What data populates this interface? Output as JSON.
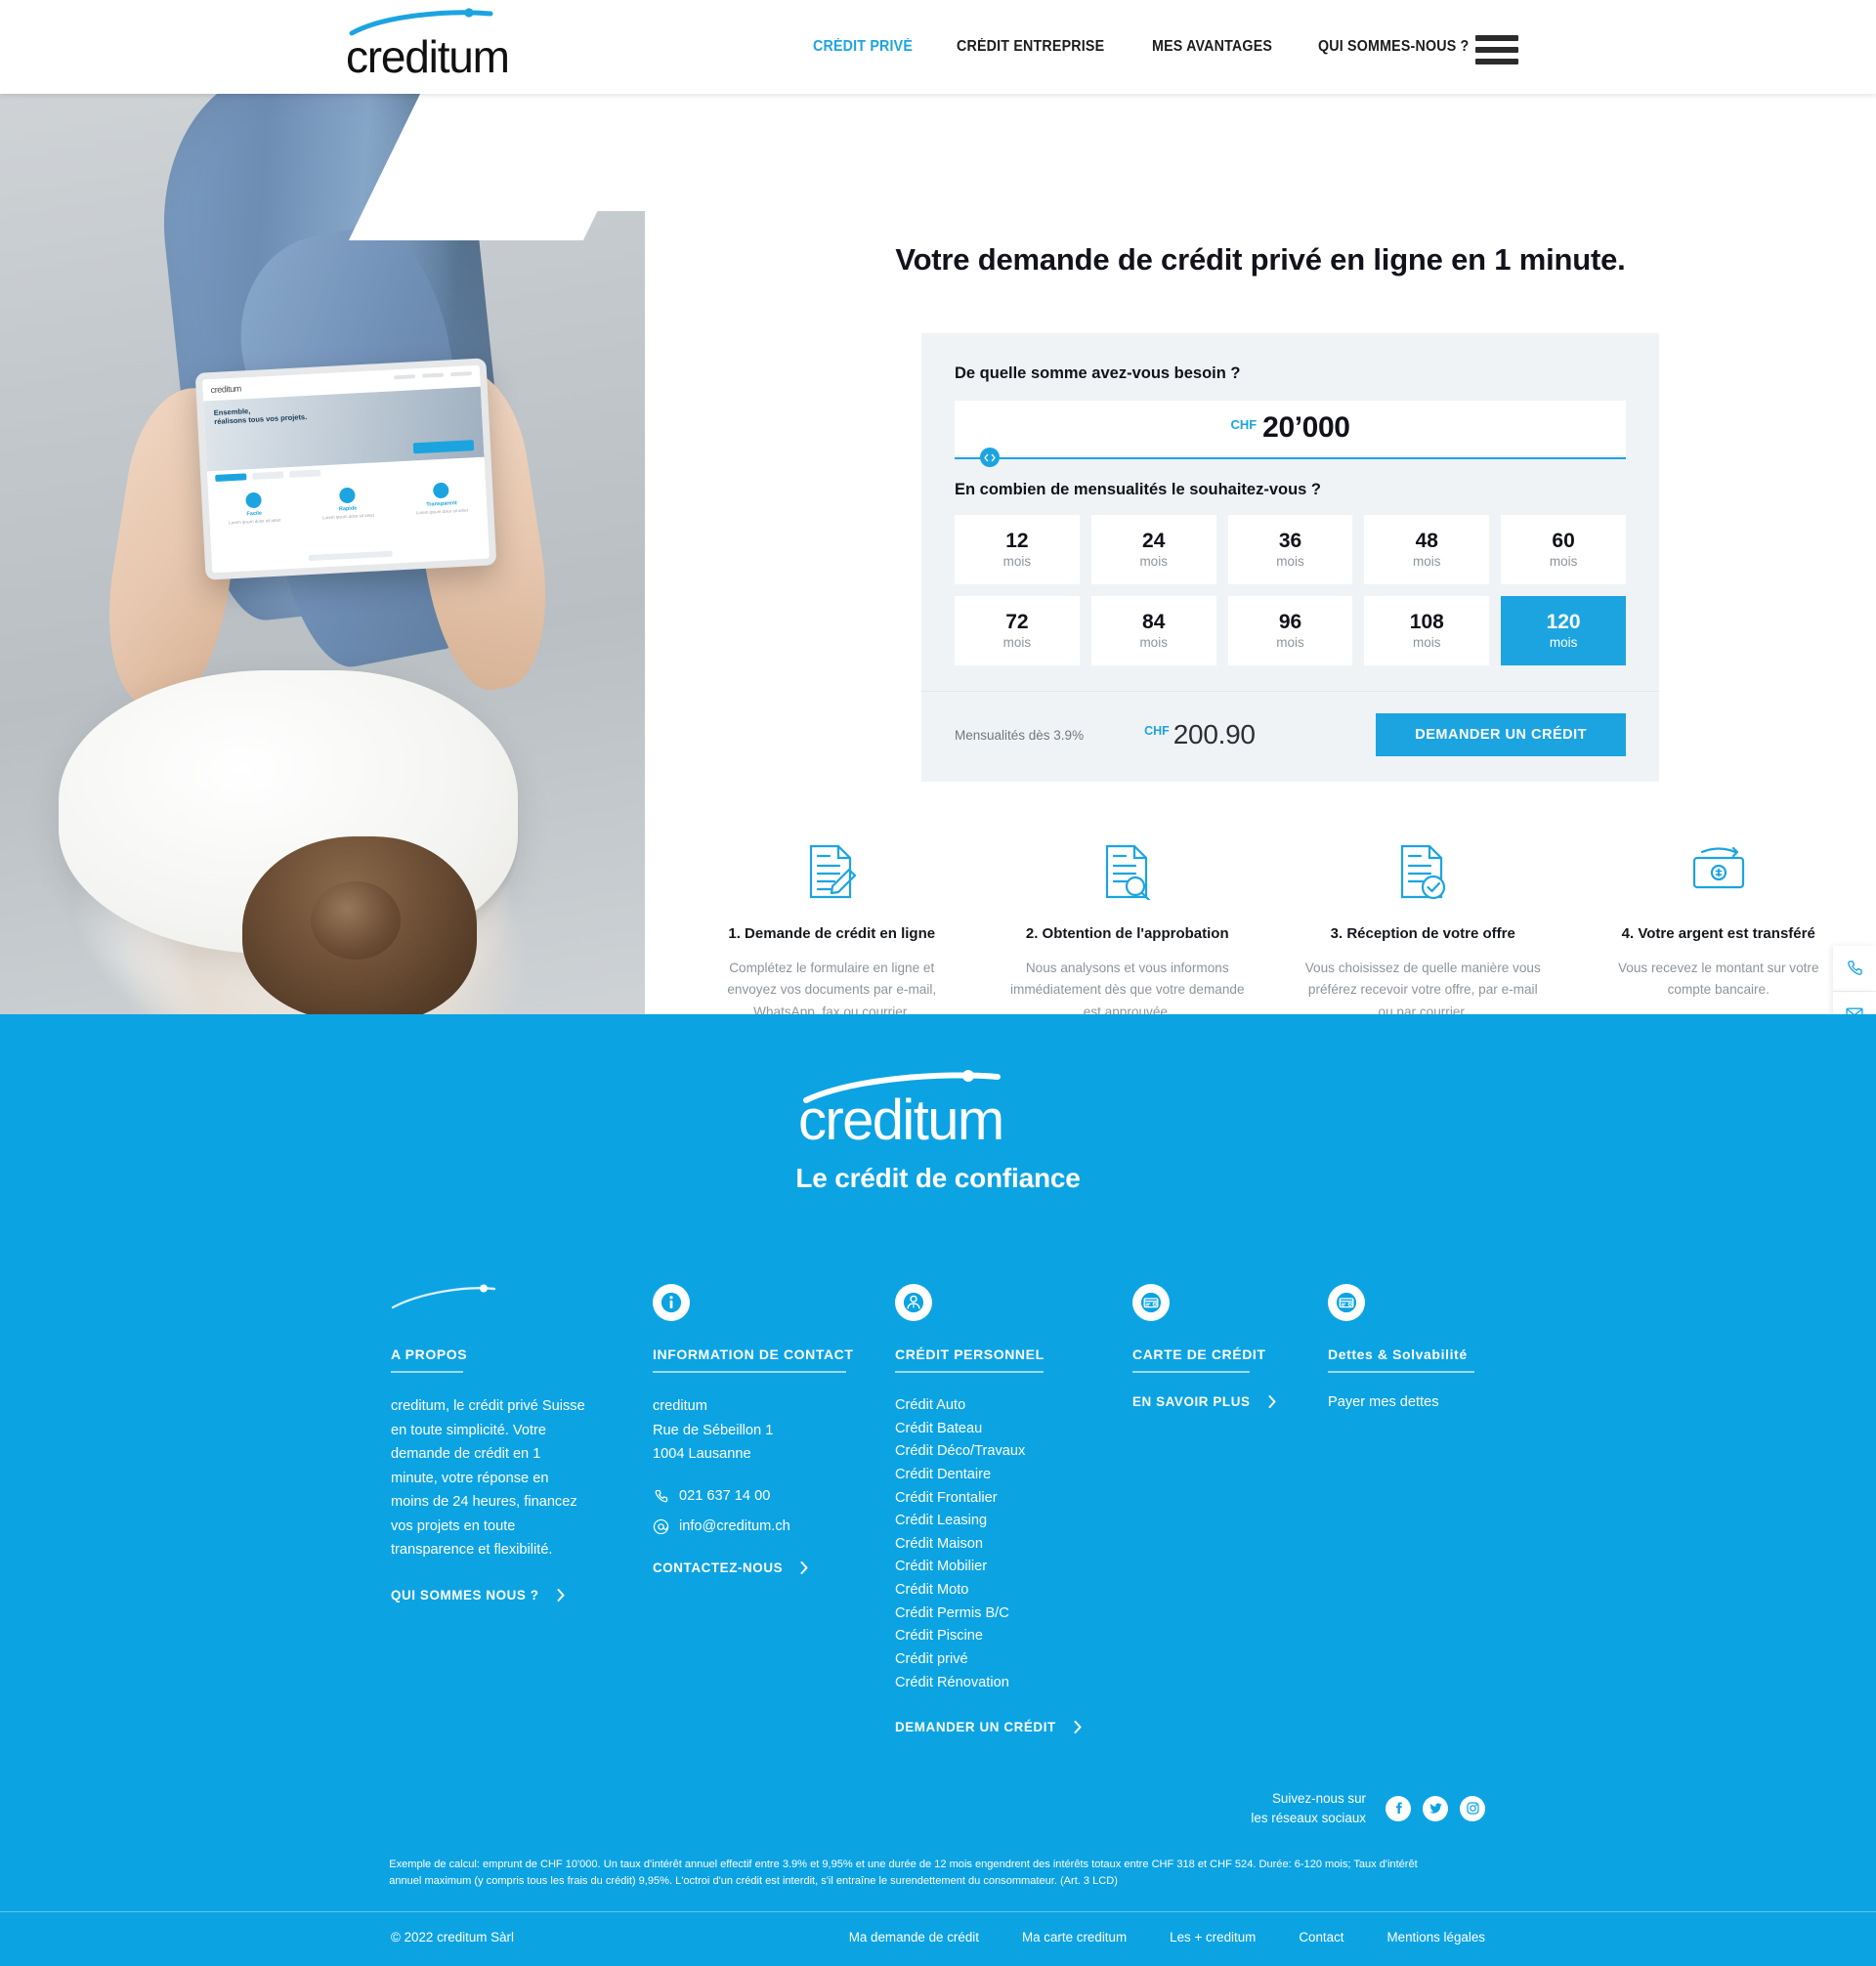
{
  "brand": {
    "name": "creditum",
    "accent": "#1ca4e0",
    "footer_bg": "#0ca3e3"
  },
  "header": {
    "logo_text": "creditum",
    "nav": [
      {
        "label": "CRÉDIT PRIVÉ",
        "active": true
      },
      {
        "label": "CRÉDIT ENTREPRISE",
        "active": false
      },
      {
        "label": "MES AVANTAGES",
        "active": false
      },
      {
        "label": "QUI SOMMES-NOUS ?",
        "active": false
      }
    ],
    "menu_icon": "hamburger-icon"
  },
  "hero": {
    "title": "Votre demande de crédit privé en ligne en 1 minute.",
    "photo_alt": "woman-lying-on-couch-with-tablet",
    "tablet": {
      "logo": "creditum",
      "headline_line1": "Ensemble,",
      "headline_line2": "réalisons tous vos projets.",
      "features": [
        {
          "label": "Facile"
        },
        {
          "label": "Rapide"
        },
        {
          "label": "Transparent"
        }
      ]
    }
  },
  "calculator": {
    "amount_question": "De quelle somme avez-vous besoin ?",
    "currency": "CHF",
    "amount_value": "20’000",
    "slider_percent": 4,
    "months_question": "En combien de mensualités le souhaitez-vous ?",
    "unit": "mois",
    "months": [
      {
        "value": "12",
        "selected": false
      },
      {
        "value": "24",
        "selected": false
      },
      {
        "value": "36",
        "selected": false
      },
      {
        "value": "48",
        "selected": false
      },
      {
        "value": "60",
        "selected": false
      },
      {
        "value": "72",
        "selected": false
      },
      {
        "value": "84",
        "selected": false
      },
      {
        "value": "96",
        "selected": false
      },
      {
        "value": "108",
        "selected": false
      },
      {
        "value": "120",
        "selected": true
      }
    ],
    "rate_label": "Mensualités dès 3.9%",
    "monthly_currency": "CHF",
    "monthly_value": "200.90",
    "cta_label": "DEMANDER UN CRÉDIT"
  },
  "steps": [
    {
      "icon": "document-pencil-icon",
      "title": "1. Demande de crédit en ligne",
      "desc": "Complétez le formulaire en ligne et envoyez vos documents par e-mail, WhatsApp, fax ou courrier."
    },
    {
      "icon": "document-search-icon",
      "title": "2. Obtention de l'approbation",
      "desc": "Nous analysons et vous informons immédiatement dès que votre demande est approuvée."
    },
    {
      "icon": "document-check-icon",
      "title": "3. Réception de votre offre",
      "desc": "Vous choisissez de quelle manière vous préférez recevoir votre offre, par e-mail ou par courrier."
    },
    {
      "icon": "money-transfer-icon",
      "title": "4. Votre argent est transféré",
      "desc": "Vous recevez le montant sur votre compte bancaire."
    }
  ],
  "side_sticky": [
    {
      "icon": "phone-icon"
    },
    {
      "icon": "mail-icon"
    },
    {
      "icon": "clipboard-icon"
    },
    {
      "icon": "chevron-up-icon"
    }
  ],
  "footer": {
    "logo_text": "creditum",
    "tagline": "Le crédit de confiance",
    "about": {
      "icon": "swoosh-icon",
      "heading": "A PROPOS",
      "body": "creditum, le crédit privé Suisse en toute simplicité. Votre demande de crédit en 1 minute, votre réponse en moins de 24 heures, financez vos projets en toute transparence et flexibilité.",
      "link": "QUI SOMMES NOUS ?"
    },
    "contact": {
      "icon": "info-icon",
      "heading": "INFORMATION DE CONTACT",
      "company": "creditum",
      "street": "Rue de Sébeillon 1",
      "city": "1004 Lausanne",
      "phone_icon": "phone-icon",
      "phone": "021 637 14 00",
      "email_icon": "at-icon",
      "email": "info@creditum.ch",
      "link": "CONTACTEZ-NOUS"
    },
    "personal": {
      "icon": "advisor-icon",
      "heading": "CRÉDIT PERSONNEL",
      "items": [
        "Crédit Auto",
        "Crédit Bateau",
        "Crédit Déco/Travaux",
        "Crédit Dentaire",
        "Crédit Frontalier",
        "Crédit Leasing",
        "Crédit Maison",
        "Crédit Mobilier",
        "Crédit Moto",
        "Crédit Permis B/C",
        "Crédit Piscine",
        "Crédit privé",
        "Crédit Rénovation"
      ],
      "link": "DEMANDER UN CRÉDIT"
    },
    "card": {
      "icon": "credit-card-icon",
      "heading": "CARTE DE CRÉDIT",
      "link": "EN SAVOIR PLUS"
    },
    "debts": {
      "icon": "credit-card-icon",
      "heading": "Dettes & Solvabilité",
      "item": "Payer mes dettes"
    },
    "social": {
      "text_line1": "Suivez-nous sur",
      "text_line2": "les réseaux sociaux",
      "networks": [
        {
          "name": "facebook-icon"
        },
        {
          "name": "twitter-icon"
        },
        {
          "name": "instagram-icon"
        }
      ]
    },
    "legal": "Exemple de calcul: emprunt de CHF 10'000. Un taux d'intérêt annuel effectif entre 3.9% et 9,95% et une durée de 12 mois engendrent des intérêts totaux entre CHF 318 et CHF 524. Durée: 6-120 mois; Taux d'intérêt annuel maximum (y compris tous les frais du crédit) 9,95%. L'octroi d'un crédit est interdit, s'il entraîne le surendettement du consommateur. (Art. 3 LCD)",
    "copyright": "© 2022 creditum Sàrl",
    "bottom_links": [
      "Ma demande de crédit",
      "Ma carte creditum",
      "Les + creditum",
      "Contact",
      "Mentions légales"
    ]
  }
}
